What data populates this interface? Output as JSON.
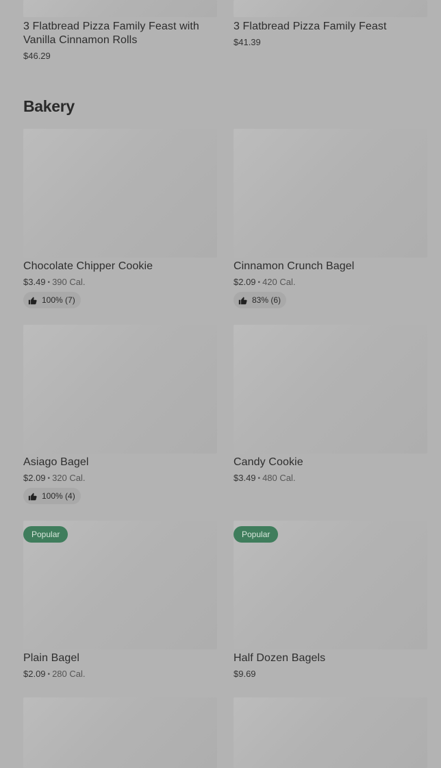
{
  "top_items": [
    {
      "name": "3 Flatbread Pizza Family Feast with Vanilla Cinnamon Rolls",
      "price": "$46.29"
    },
    {
      "name": "3 Flatbread Pizza Family Feast",
      "price": "$41.39"
    }
  ],
  "section": {
    "title": "Bakery"
  },
  "items": [
    {
      "name": "Chocolate Chipper Cookie",
      "price": "$3.49",
      "separator": "•",
      "calories": "390 Cal.",
      "rating": "100% (7)"
    },
    {
      "name": "Cinnamon Crunch Bagel",
      "price": "$2.09",
      "separator": "•",
      "calories": "420 Cal.",
      "rating": "83% (6)"
    },
    {
      "name": "Asiago Bagel",
      "price": "$2.09",
      "separator": "•",
      "calories": "320 Cal.",
      "rating": "100% (4)"
    },
    {
      "name": "Candy Cookie",
      "price": "$3.49",
      "separator": "•",
      "calories": "480 Cal."
    },
    {
      "name": "Plain Bagel",
      "price": "$2.09",
      "separator": "•",
      "calories": "280 Cal.",
      "badge": "Popular"
    },
    {
      "name": "Half Dozen Bagels",
      "price": "$9.69",
      "badge": "Popular"
    }
  ],
  "icons": {
    "rating": "thumbs-up-icon"
  },
  "colors": {
    "background": "#b3b3b3",
    "badge": "#3f7d5c",
    "rating_pill": "#a9a9a9"
  }
}
